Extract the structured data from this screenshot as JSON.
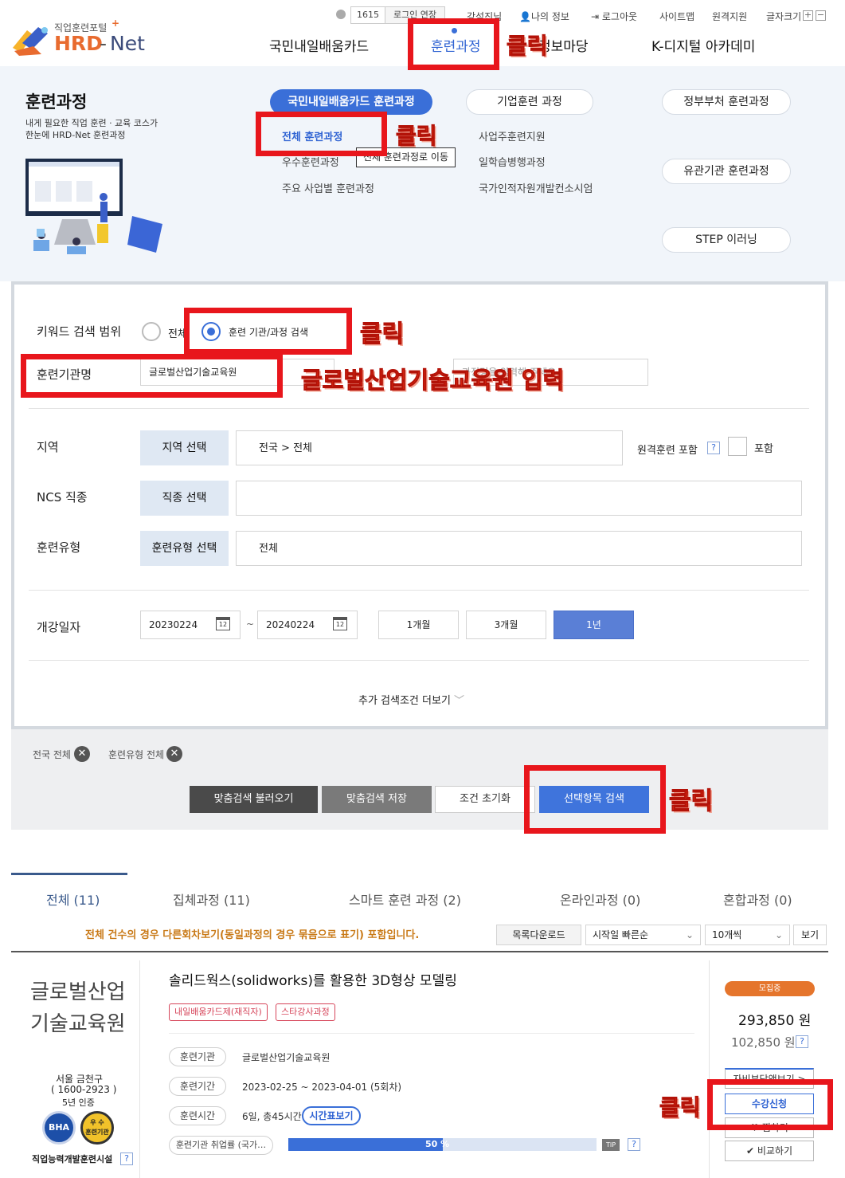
{
  "brand": {
    "logo_top": "직업훈련포털",
    "logo_main": "HRD",
    "logo_net": "Net"
  },
  "topbar": {
    "timer": "1615",
    "extend": "로그인 연장",
    "lecture": "강석진님",
    "myinfo": "나의 정보",
    "logout": "로그아웃",
    "sitemap": "사이트맵",
    "remote": "원격지원",
    "fontsize": "글자크기"
  },
  "gnb": {
    "item1": "국민내일배움카드",
    "item2": "훈련과정",
    "item3": "정보마당",
    "item4": "K-디지털 아카데미"
  },
  "mega": {
    "title": "훈련과정",
    "desc1": "내게 필요한 직업 훈련 · 교육 코스가",
    "desc2": "한눈에 HRD-Net 훈련과정",
    "card_tab": "국민내일배움카드 훈련과정",
    "corp_tab": "기업훈련 과정",
    "gov_tab": "정부부처 훈련과정",
    "related_tab": "유관기관 훈련과정",
    "step_tab": "STEP 이러닝",
    "col1": [
      "전체 훈련과정",
      "우수훈련과정",
      "주요 사업별 훈련과정"
    ],
    "col2": [
      "사업주훈련지원",
      "일학습병행과정",
      "국가인적자원개발컨소시엄"
    ],
    "tooltip": "전체 훈련과정로 이동"
  },
  "search": {
    "scope_label": "키워드 검색 범위",
    "scope_all": "전체",
    "scope_inst": "훈련 기관/과정 검색",
    "inst_label": "훈련기관명",
    "inst_value": "글로벌산업기술교육원",
    "course_placeholder": "과정명을 입력해 주세요.",
    "region_label": "지역",
    "region_btn": "지역 선택",
    "region_value": "전국 > 전체",
    "remote_label": "원격훈련 포함",
    "remote_help": "?",
    "remote_include": "포함",
    "ncs_label": "NCS 직종",
    "ncs_btn": "직종 선택",
    "type_label": "훈련유형",
    "type_btn": "훈련유형 선택",
    "type_value": "전체",
    "date_label": "개강일자",
    "date_from": "20230224",
    "date_to": "20240224",
    "date_sep": "~",
    "cal_icon": "12",
    "period": [
      "1개월",
      "3개월",
      "1년"
    ],
    "more": "추가 검색조건 더보기"
  },
  "filters": {
    "chip1": "전국 전체",
    "chip2": "훈련유형 전체"
  },
  "actions": {
    "load": "맞춤검색 불러오기",
    "save": "맞춤검색 저장",
    "reset": "조건 초기화",
    "search": "선택항목 검색"
  },
  "result_tabs": [
    "전체 (11)",
    "집체과정 (11)",
    "스마트 훈련 과정 (2)",
    "온라인과정 (0)",
    "혼합과정 (0)"
  ],
  "result_bar": {
    "notice": "전체 건수의 경우 다른회차보기(동일과정의 경우 묶음으로 표기) 포함입니다.",
    "download": "목록다운로드",
    "sort": "시작일 빠른순",
    "count": "10개씩",
    "view": "보기"
  },
  "course": {
    "inst_line1": "글로벌산업",
    "inst_line2": "기술교육원",
    "loc": "서울 금천구",
    "phone": "( 1600-2923 )",
    "cert": "5년 인증",
    "badge1": "BHA",
    "badge2_top": "우 수",
    "badge2_bot": "훈련기관",
    "inst_type": "직업능력개발훈련시설",
    "help": "?",
    "title": "솔리드웍스(solidworks)를 활용한 3D형상 모델링",
    "tags": [
      "내일배움카드제(재직자)",
      "스타강사과정"
    ],
    "rows": [
      {
        "key": "훈련기관",
        "val": "글로벌산업기술교육원"
      },
      {
        "key": "훈련기간",
        "val": "2023-02-25 ~ 2023-04-01 (5회차)"
      },
      {
        "key": "훈련시간",
        "val": "6일, 총45시간"
      }
    ],
    "timetable": "시간표보기",
    "employ_label": "훈련기관 취업률 (국가…",
    "employ_value": "50 %",
    "employ_rate": 0.5,
    "tip": "TIP",
    "status": "모집중",
    "price": "293,850 원",
    "self_price": "102,850 원",
    "self_help": "?",
    "btn_self": "자비부담액보기 >",
    "btn_apply": "수강신청",
    "btn_wish": "찜하기",
    "btn_compare": "비교하기"
  },
  "annotations": {
    "click": "클릭",
    "input_hint": "글로벌산업기술교육원 입력"
  },
  "colors": {
    "accent": "#3a6fd8",
    "red": "#e8161c",
    "primary_btn": "#3f74dc"
  }
}
